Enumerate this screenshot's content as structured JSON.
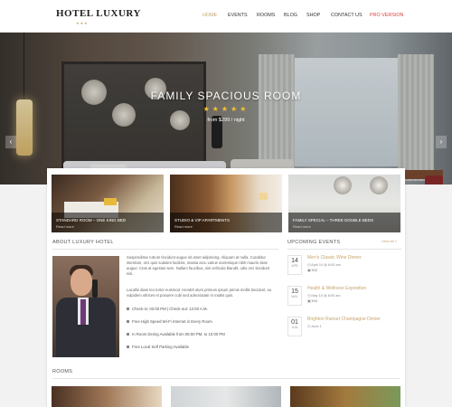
{
  "brand": {
    "name": "HOTEL LUXURY",
    "stars": "★★★"
  },
  "nav": {
    "items": [
      "HOME",
      "EVENTS",
      "ROOMS",
      "BLOG",
      "SHOP",
      "CONTACT US",
      "PRO VERSION"
    ],
    "active": "HOME",
    "accent": "#c7a46d",
    "pro_color": "#d9403a"
  },
  "hero": {
    "title": "FAMILY SPACIOUS ROOM",
    "stars": "★★★★★",
    "price": "from $299 / night",
    "prev_arrow": "‹",
    "next_arrow": "›"
  },
  "featured_rooms": [
    {
      "title": "STANDARD ROOM – ONE KING BED",
      "link": "Read more"
    },
    {
      "title": "STUDIO & VIP APARTMENTS",
      "link": "Read more"
    },
    {
      "title": "FAMILY SPECIAL – THREE DOUBLE BEDS",
      "link": "Read more"
    }
  ],
  "about": {
    "heading": "ABOUT LUXURY HOTEL",
    "paragraph1": "Suspendisse rutrum tincidunt augue sit amet adipiscing. Aliquam at nulla. Curabitur interdum, orci quis sodales facilisis, massa arcu varius scelerisque nibh mauris vitae augue. Cras at egestas sem. Nullam faucibus, nisi vehicula blandit, odio orci tincidunt nisi.",
    "paragraph2": "Lacullis diam leo tortor euismod. Hendrit ulum primum ipsum primis mollis tincidunt, eu vulpidem ultrices et posuere cubi sed adecviatate in mattis quis.",
    "features": [
      "Check-in: 02:00 PM | Check-out: 12:00 A.M.",
      "Free High Speed Wi-Fi Internet in Every Room",
      "In Room Dining Available from 06:00 PM. to 10:00 PM",
      "Free Local Self Parking Available"
    ]
  },
  "events": {
    "heading": "UPCOMING EVENTS",
    "view_all": "View All »",
    "items": [
      {
        "day": "14",
        "month": "APR",
        "title": "Men's Classic Wine Dinner",
        "meta": "April 14 @ 8:00 am",
        "price": "$98"
      },
      {
        "day": "15",
        "month": "MAY",
        "title": "Health & Wellness Exposition",
        "meta": "May 15 @ 8:00 am",
        "price": "$98"
      },
      {
        "day": "01",
        "month": "JUN",
        "title": "Brighton Ruinart Champagne Dinner",
        "meta": "June 1",
        "price": ""
      }
    ]
  },
  "rooms_section": {
    "heading": "ROOMS"
  }
}
